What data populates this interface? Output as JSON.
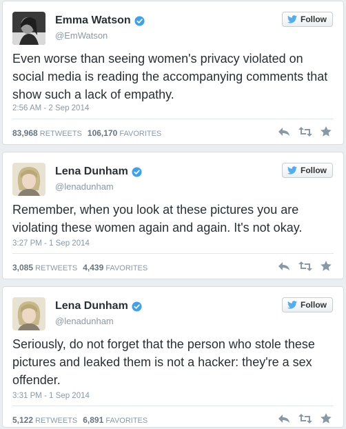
{
  "tweets": [
    {
      "name": "Emma Watson",
      "handle": "@EmWatson",
      "follow_label": "Follow",
      "text": "Even worse than seeing women's privacy violated on social media is reading the accompanying comments that show such a lack of empathy.",
      "time": "2:56 AM - 2 Sep 2014",
      "retweets": "83,968",
      "retweets_label": "RETWEETS",
      "favorites": "106,170",
      "favorites_label": "FAVORITES"
    },
    {
      "name": "Lena Dunham",
      "handle": "@lenadunham",
      "follow_label": "Follow",
      "text": "Remember, when you look at these pictures you are violating these women again and again. It's not okay.",
      "time": "3:27 PM - 1 Sep 2014",
      "retweets": "3,085",
      "retweets_label": "RETWEETS",
      "favorites": "4,439",
      "favorites_label": "FAVORITES"
    },
    {
      "name": "Lena Dunham",
      "handle": "@lenadunham",
      "follow_label": "Follow",
      "text": "Seriously, do not forget that the person who stole these pictures and leaked them is not a hacker: they're a sex offender.",
      "time": "3:31 PM - 1 Sep 2014",
      "retweets": "5,122",
      "retweets_label": "RETWEETS",
      "favorites": "6,891",
      "favorites_label": "FAVORITES"
    }
  ],
  "colors": {
    "verified": "#3ea1ec",
    "bird": "#55acee",
    "action_icon": "#8899a6"
  }
}
